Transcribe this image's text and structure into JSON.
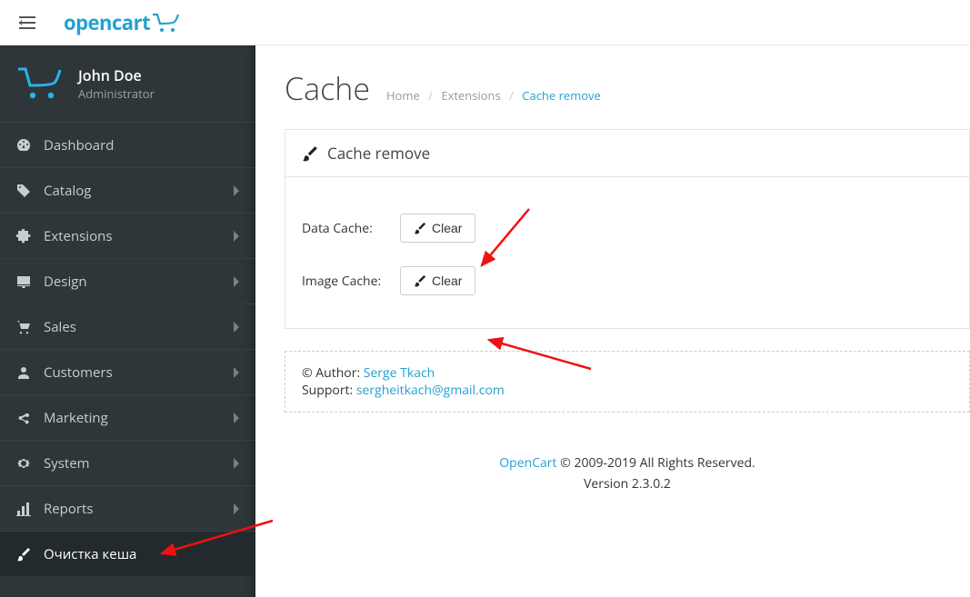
{
  "header": {
    "logo_text": "opencart"
  },
  "user": {
    "name": "John Doe",
    "role": "Administrator"
  },
  "sidebar": {
    "items": [
      {
        "label": "Dashboard",
        "icon": "dashboard",
        "expandable": false
      },
      {
        "label": "Catalog",
        "icon": "tag",
        "expandable": true
      },
      {
        "label": "Extensions",
        "icon": "puzzle",
        "expandable": true
      },
      {
        "label": "Design",
        "icon": "desktop",
        "expandable": true
      },
      {
        "label": "Sales",
        "icon": "cart",
        "expandable": true
      },
      {
        "label": "Customers",
        "icon": "user",
        "expandable": true
      },
      {
        "label": "Marketing",
        "icon": "share",
        "expandable": true
      },
      {
        "label": "System",
        "icon": "cog",
        "expandable": true
      },
      {
        "label": "Reports",
        "icon": "bar-chart",
        "expandable": true
      },
      {
        "label": "Очистка кеша",
        "icon": "brush",
        "expandable": false,
        "active": true
      }
    ]
  },
  "page": {
    "title": "Cache",
    "breadcrumb": [
      {
        "label": "Home",
        "active": false
      },
      {
        "label": "Extensions",
        "active": false
      },
      {
        "label": "Cache remove",
        "active": true
      }
    ]
  },
  "panel": {
    "title": "Cache remove"
  },
  "form": {
    "data_cache_label": "Data Cache:",
    "image_cache_label": "Image Cache:",
    "clear_btn": "Clear"
  },
  "author": {
    "prefix": "© Author: ",
    "name": "Serge Tkach",
    "support_prefix": "Support: ",
    "email": "sergheitkach@gmail.com"
  },
  "footer": {
    "brand": "OpenCart",
    "copyright": " © 2009-2019 All Rights Reserved.",
    "version": "Version 2.3.0.2"
  }
}
